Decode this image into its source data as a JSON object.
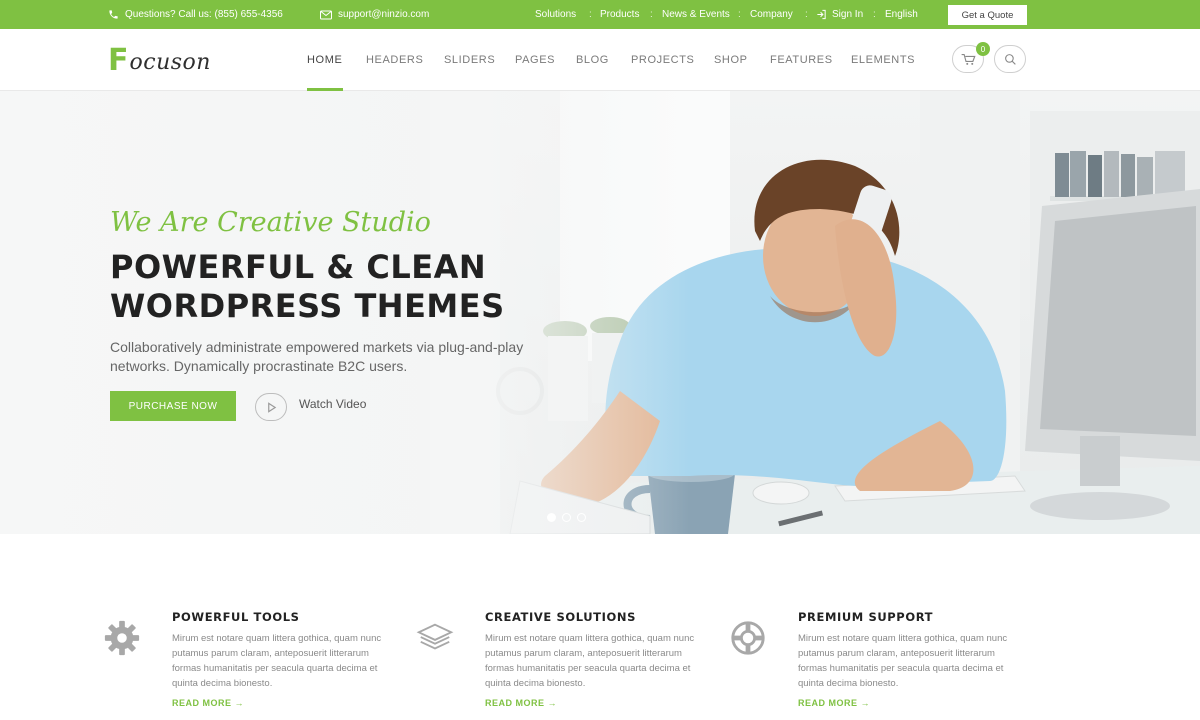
{
  "colors": {
    "accent": "#7fc142",
    "dark_text": "#222222",
    "muted_text": "#8a8a8a"
  },
  "topbar": {
    "phone_icon": "phone-icon",
    "phone_text": "Questions? Call us: (855) 655-4356",
    "email_icon": "envelope-icon",
    "email_text": "support@ninzio.com",
    "links": [
      "Solutions",
      "Products",
      "News & Events",
      "Company"
    ],
    "signin_icon": "sign-in-icon",
    "signin_label": "Sign In",
    "language": "English",
    "quote_label": "Get a Quote"
  },
  "header": {
    "logo_first": "F",
    "logo_rest": "ocuson",
    "nav": [
      "HOME",
      "HEADERS",
      "SLIDERS",
      "PAGES",
      "BLOG",
      "PROJECTS",
      "SHOP",
      "FEATURES",
      "ELEMENTS"
    ],
    "active_nav": "HOME",
    "cart_icon": "cart-icon",
    "cart_count": "0",
    "search_icon": "search-icon"
  },
  "hero": {
    "script_title": "We Are Creative Studio",
    "title_line1": "POWERFUL & CLEAN",
    "title_line2": "WORDPRESS THEMES",
    "description": "Collaboratively administrate empowered markets via plug-and-play networks. Dynamically procrastinate B2C users.",
    "purchase_label": "PURCHASE NOW",
    "play_icon": "play-icon",
    "watch_label": "Watch Video",
    "slides_total": 3,
    "active_slide": 1
  },
  "features": [
    {
      "icon": "gear-icon",
      "title": "POWERFUL TOOLS",
      "text": "Mirum est notare quam littera gothica, quam nunc putamus parum claram, anteposuerit litterarum formas humanitatis per seacula quarta decima et quinta decima bionesto.",
      "more": "READ MORE"
    },
    {
      "icon": "layers-icon",
      "title": "CREATIVE SOLUTIONS",
      "text": "Mirum est notare quam littera gothica, quam nunc putamus parum claram, anteposuerit litterarum formas humanitatis per seacula quarta decima et quinta decima bionesto.",
      "more": "READ MORE"
    },
    {
      "icon": "lifebuoy-icon",
      "title": "PREMIUM SUPPORT",
      "text": "Mirum est notare quam littera gothica, quam nunc putamus parum claram, anteposuerit litterarum formas humanitatis per seacula quarta decima et quinta decima bionesto.",
      "more": "READ MORE"
    }
  ]
}
